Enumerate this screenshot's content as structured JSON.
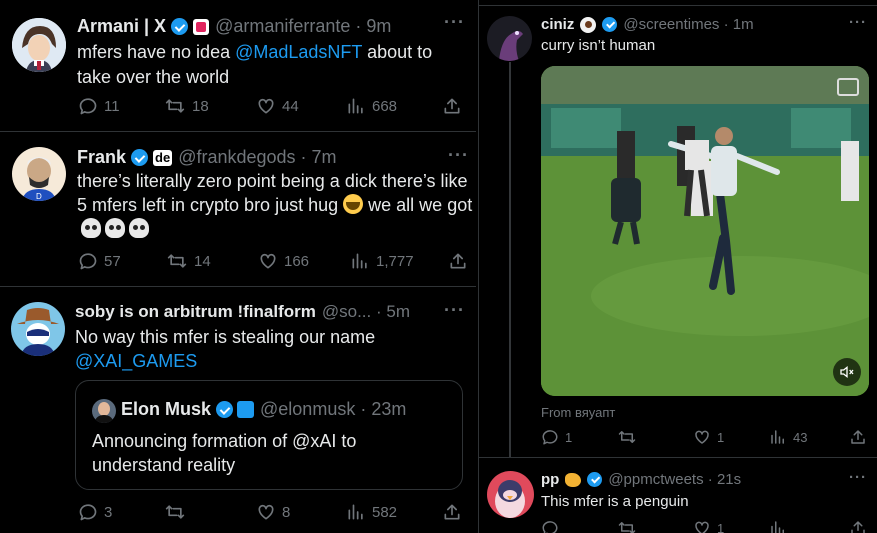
{
  "left": {
    "tweets": [
      {
        "name": "Armani | X",
        "handle": "@armaniferrante",
        "time": "9m",
        "text_a": "mfers have no idea ",
        "mention": "@MadLadsNFT",
        "text_b": " about to take over the world",
        "replies": "11",
        "retweets": "18",
        "likes": "44",
        "views": "668"
      },
      {
        "name": "Frank",
        "handle": "@frankdegods",
        "time": "7m",
        "affiliate": "de",
        "text": "there’s literally zero point being a dick there’s like 5 mfers left in crypto bro just hug",
        "text_tail": "we all we got",
        "replies": "57",
        "retweets": "14",
        "likes": "166",
        "views": "1,777"
      },
      {
        "name": "soby is on arbitrum !finalform",
        "handle": "@so...",
        "time": "5m",
        "text": "No way this mfer is stealing our name",
        "mention": "@XAI_GAMES",
        "quote": {
          "name": "Elon Musk",
          "handle": "@elonmusk",
          "time": "23m",
          "text": "Announcing formation of @xAI to understand reality"
        },
        "replies": "3",
        "retweets": "",
        "likes": "8",
        "views": "582"
      }
    ]
  },
  "right": {
    "tweets": [
      {
        "name": "ciniz",
        "handle": "@screentimes",
        "time": "1m",
        "text": "curry isn’t human",
        "source": "From вяуапт",
        "replies": "1",
        "retweets": "",
        "likes": "1",
        "views": "43"
      },
      {
        "name": "pp",
        "handle": "@ppmctweets",
        "time": "21s",
        "text": "This mfer is a penguin",
        "replies": "",
        "retweets": "",
        "likes": "1",
        "views": ""
      }
    ]
  },
  "colors": {
    "background": "#000000",
    "text": "#e7e9ea",
    "muted": "#71767b",
    "link": "#1d9bf0",
    "border": "#2f3336"
  },
  "icons": [
    "verified-badge-icon",
    "reply-icon",
    "retweet-icon",
    "like-icon",
    "views-icon",
    "share-icon",
    "more-icon",
    "mute-icon",
    "alt-icon"
  ]
}
